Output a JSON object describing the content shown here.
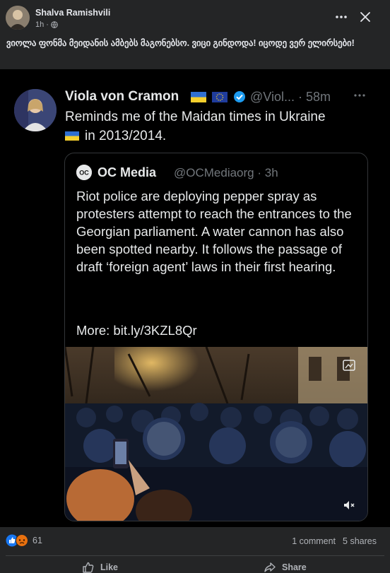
{
  "post": {
    "author": "Shalva Ramishvili",
    "time": "1h",
    "caption": "ვიოლა ფონმა მეიდანის ამბებს მაგონებსო. ვიცი გინდოდა! იცოდე ვერ ელირსები!"
  },
  "tweet": {
    "name": "Viola von Cramon",
    "handle": "@Viol...",
    "time": "· 58m",
    "text_line1": "Reminds me of the Maidan times in Ukraine",
    "text_line2": "in 2013/2014."
  },
  "quote": {
    "name": "OC Media",
    "handle": "@OCMediaorg · 3h",
    "text": "Riot police are deploying pepper spray as protesters attempt to reach the entrances to the Georgian parliament. A water cannon has also been spotted nearby. It follows the passage of draft ‘foreign agent’ laws in their first hearing.",
    "more": "More: bit.ly/3KZL8Qr",
    "logo_text": "OC"
  },
  "footer": {
    "reaction_count": "61",
    "comments": "1 comment",
    "shares": "5 shares",
    "like_label": "Like",
    "share_label": "Share"
  },
  "icons": [
    "globe-icon",
    "more-icon",
    "close-icon",
    "ukraine-flag-icon",
    "eu-flag-icon",
    "verified-icon",
    "media-icon",
    "mute-icon",
    "like-reaction-icon",
    "angry-reaction-icon",
    "like-icon",
    "share-icon"
  ],
  "colors": {
    "background": "#242526",
    "tweet_bg": "#000000",
    "verified": "#1d9bf0",
    "like_reaction": "#1877f2"
  }
}
